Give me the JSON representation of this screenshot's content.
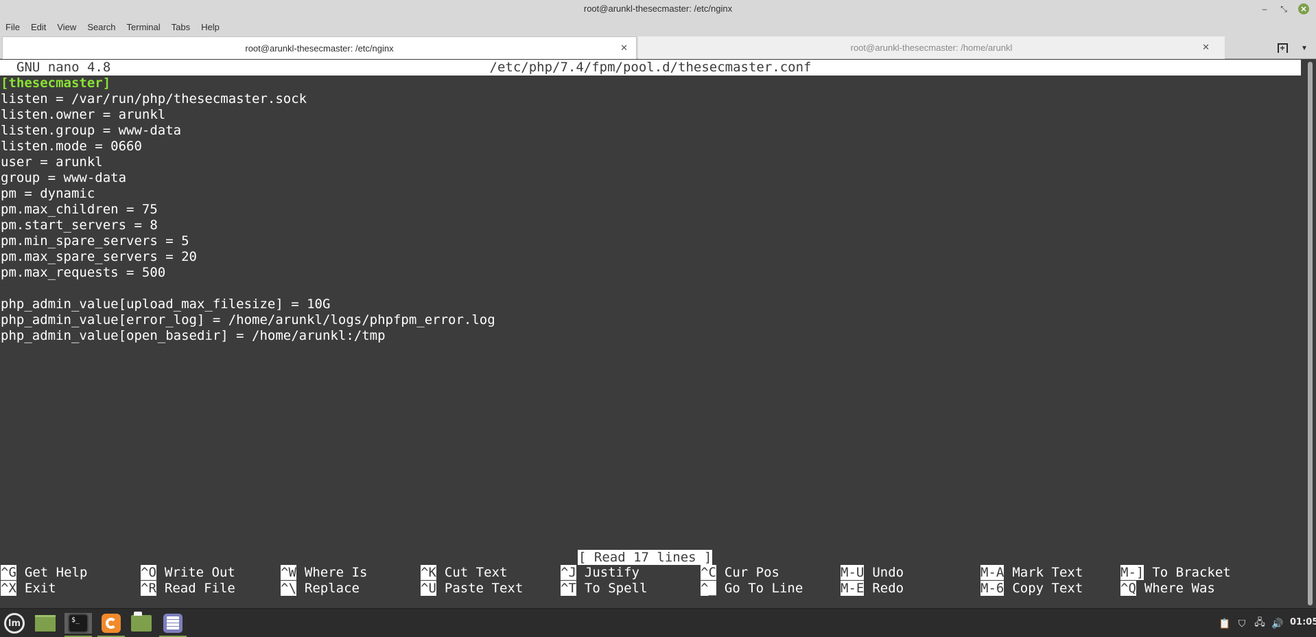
{
  "window": {
    "title": "root@arunkl-thesecmaster: /etc/nginx",
    "controls": {
      "minimize": "–",
      "maximize": "⤡",
      "close": "✕"
    }
  },
  "menubar": [
    "File",
    "Edit",
    "View",
    "Search",
    "Terminal",
    "Tabs",
    "Help"
  ],
  "tabs": [
    {
      "label": "root@arunkl-thesecmaster: /etc/nginx",
      "active": true,
      "close": "✕"
    },
    {
      "label": "root@arunkl-thesecmaster: /home/arunkl",
      "active": false,
      "close": "✕"
    }
  ],
  "tab_tools": {
    "new_tab": "+",
    "menu": "▼"
  },
  "nano": {
    "version": "GNU nano 4.8",
    "filename": "/etc/php/7.4/fpm/pool.d/thesecmaster.conf",
    "lines": [
      "[thesecmaster]",
      "listen = /var/run/php/thesecmaster.sock",
      "listen.owner = arunkl",
      "listen.group = www-data",
      "listen.mode = 0660",
      "user = arunkl",
      "group = www-data",
      "pm = dynamic",
      "pm.max_children = 75",
      "pm.start_servers = 8",
      "pm.min_spare_servers = 5",
      "pm.max_spare_servers = 20",
      "pm.max_requests = 500",
      "",
      "php_admin_value[upload_max_filesize] = 10G",
      "php_admin_value[error_log] = /home/arunkl/logs/phpfpm_error.log",
      "php_admin_value[open_basedir] = /home/arunkl:/tmp"
    ],
    "status": "[ Read 17 lines ]",
    "shortcuts": [
      [
        {
          "key": "^G",
          "label": "Get Help"
        },
        {
          "key": "^O",
          "label": "Write Out"
        },
        {
          "key": "^W",
          "label": "Where Is"
        },
        {
          "key": "^K",
          "label": "Cut Text"
        },
        {
          "key": "^J",
          "label": "Justify"
        },
        {
          "key": "^C",
          "label": "Cur Pos"
        },
        {
          "key": "M-U",
          "label": "Undo"
        },
        {
          "key": "M-A",
          "label": "Mark Text"
        },
        {
          "key": "M-]",
          "label": "To Bracket"
        }
      ],
      [
        {
          "key": "^X",
          "label": "Exit"
        },
        {
          "key": "^R",
          "label": "Read File"
        },
        {
          "key": "^\\",
          "label": "Replace"
        },
        {
          "key": "^U",
          "label": "Paste Text"
        },
        {
          "key": "^T",
          "label": "To Spell"
        },
        {
          "key": "^_",
          "label": "Go To Line"
        },
        {
          "key": "M-E",
          "label": "Redo"
        },
        {
          "key": "M-6",
          "label": "Copy Text"
        },
        {
          "key": "^Q",
          "label": "Where Was"
        }
      ]
    ]
  },
  "taskbar": {
    "launchers": [
      "mint-menu",
      "show-desktop",
      "terminal",
      "firefox",
      "files",
      "text-editor"
    ],
    "term_glyph": "$_",
    "mint_glyph": "lm",
    "tray": [
      "clipboard",
      "shield",
      "network",
      "volume"
    ],
    "tray_glyphs": {
      "clipboard": "📋",
      "shield": "⛉",
      "network": "🖧",
      "volume": "🔊"
    },
    "clock": "01:05"
  },
  "colors": {
    "terminal_bg": "#3c3c3c",
    "section_header": "#8ae234",
    "accent_green": "#7ea04c"
  }
}
